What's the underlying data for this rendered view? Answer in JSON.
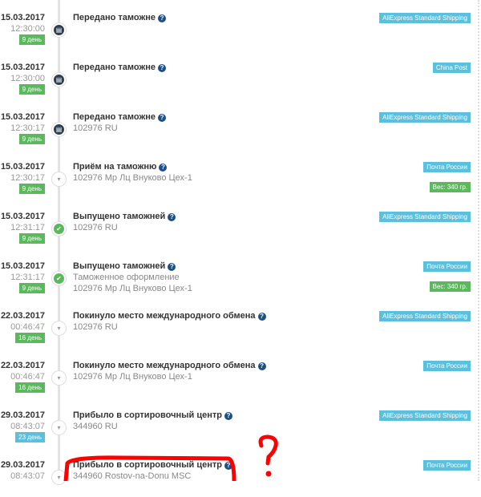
{
  "events": [
    {
      "date": "15.03.2017",
      "time": "12:30:00",
      "day": "9 день",
      "day_color": "#5cb85c",
      "icon": "doc",
      "title": "Передано таможне",
      "lines": [],
      "carrier": "AliExpress Standard Shipping"
    },
    {
      "date": "15.03.2017",
      "time": "12:30:00",
      "day": "9 день",
      "day_color": "#5cb85c",
      "icon": "doc",
      "title": "Передано таможне",
      "lines": [],
      "carrier": "China Post"
    },
    {
      "date": "15.03.2017",
      "time": "12:30:17",
      "day": "9 день",
      "day_color": "#5cb85c",
      "icon": "doc",
      "title": "Передано таможне",
      "lines": [
        "102976 RU"
      ],
      "carrier": "AliExpress Standard Shipping"
    },
    {
      "date": "15.03.2017",
      "time": "12:30:17",
      "day": "9 день",
      "day_color": "#5cb85c",
      "icon": "down",
      "title": "Приём на таможню",
      "lines": [
        "102976 Мр Лц Внуково Цех-1"
      ],
      "carrier": "Почта России",
      "weight": "Вес: 340 гр."
    },
    {
      "date": "15.03.2017",
      "time": "12:31:17",
      "day": "9 день",
      "day_color": "#5cb85c",
      "icon": "check",
      "title": "Выпущено таможней",
      "lines": [
        "102976 RU"
      ],
      "carrier": "AliExpress Standard Shipping"
    },
    {
      "date": "15.03.2017",
      "time": "12:31:17",
      "day": "9 день",
      "day_color": "#5cb85c",
      "icon": "check",
      "title": "Выпущено таможней",
      "lines": [
        "Таможенное оформление",
        "102976 Мр Лц Внуково Цех-1"
      ],
      "carrier": "Почта России",
      "weight": "Вес: 340 гр."
    },
    {
      "date": "22.03.2017",
      "time": "00:46:47",
      "day": "16 день",
      "day_color": "#5cb85c",
      "icon": "down",
      "title": "Покинуло место международного обмена",
      "lines": [
        "102976 RU"
      ],
      "carrier": "AliExpress Standard Shipping"
    },
    {
      "date": "22.03.2017",
      "time": "00:46:47",
      "day": "16 день",
      "day_color": "#5cb85c",
      "icon": "down",
      "title": "Покинуло место международного обмена",
      "lines": [
        "102976 Мр Лц Внуково Цех-1"
      ],
      "carrier": "Почта России"
    },
    {
      "date": "29.03.2017",
      "time": "08:43:07",
      "day": "23 день",
      "day_color": "#5bc0de",
      "icon": "down",
      "title": "Прибыло в сортировочный центр",
      "lines": [
        "344960 RU"
      ],
      "carrier": "AliExpress Standard Shipping"
    },
    {
      "date": "29.03.2017",
      "time": "08:43:07",
      "day": "",
      "day_color": "#5bc0de",
      "icon": "down",
      "title": "Прибыло в сортировочный центр",
      "lines": [
        "344960 Rostov-na-Donu MSC"
      ],
      "carrier": "Почта России"
    }
  ],
  "help_glyph": "?",
  "annotation": {
    "color": "#ff0000",
    "mark": "?"
  }
}
